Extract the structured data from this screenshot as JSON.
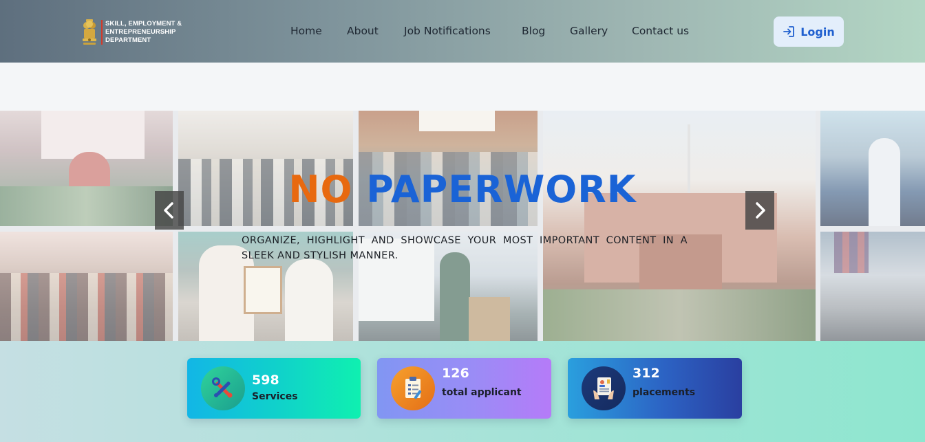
{
  "brand": {
    "line1": "SKILL, EMPLOYMENT &",
    "line2": "ENTREPRENEURSHIP",
    "line3": "DEPARTMENT",
    "emblem_icon": "state-emblem-icon",
    "accent_bar_color": "#d23a2a"
  },
  "nav": {
    "items": [
      {
        "label": "Home"
      },
      {
        "label": "About"
      },
      {
        "label": "Job Notifications"
      },
      {
        "label": "Blog"
      },
      {
        "label": "Gallery"
      },
      {
        "label": "Contact us"
      }
    ],
    "login_label": "Login",
    "login_icon": "login-arrow-icon"
  },
  "hero": {
    "title_word1": "NO",
    "title_word2": "PAPERWORK",
    "title_word1_color": "#e8690f",
    "title_word2_color": "#1a63d6",
    "subtitle": "ORGANIZE, HIGHLIGHT AND SHOWCASE YOUR MOST IMPORTANT CONTENT IN A SLEEK AND STYLISH MANNER.",
    "prev_icon": "chevron-left-icon",
    "next_icon": "chevron-right-icon"
  },
  "stats": {
    "cards": [
      {
        "value": "598",
        "label": "Services",
        "icon": "tools-icon"
      },
      {
        "value": "126",
        "label": "total applicant",
        "icon": "checklist-icon"
      },
      {
        "value": "312",
        "label": "placements",
        "icon": "resume-icon"
      }
    ]
  }
}
